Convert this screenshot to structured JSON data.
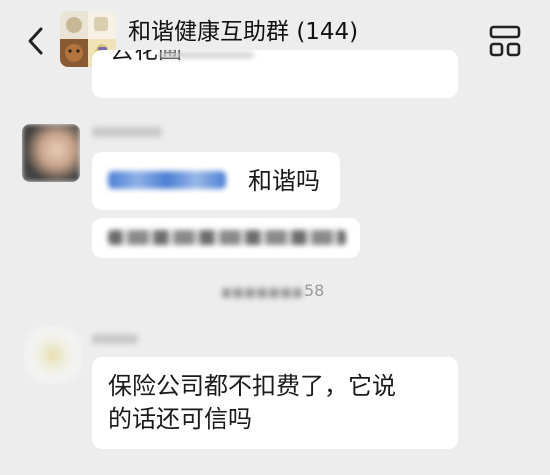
{
  "header": {
    "title": "和谐健康互助群",
    "member_count": "(144)",
    "icons": {
      "back": "chevron-left-icon",
      "more": "group-info-icon"
    }
  },
  "messages": {
    "prev_tail_text": "去花圃",
    "msg2_text": "和谐吗",
    "timestamp_visible": "58",
    "msg3_line1": "保险公司都不扣费了，它说",
    "msg3_line2": "的话还可信吗"
  },
  "colors": {
    "background": "#ededed",
    "bubble": "#ffffff",
    "mention": "#4a7fd4"
  }
}
